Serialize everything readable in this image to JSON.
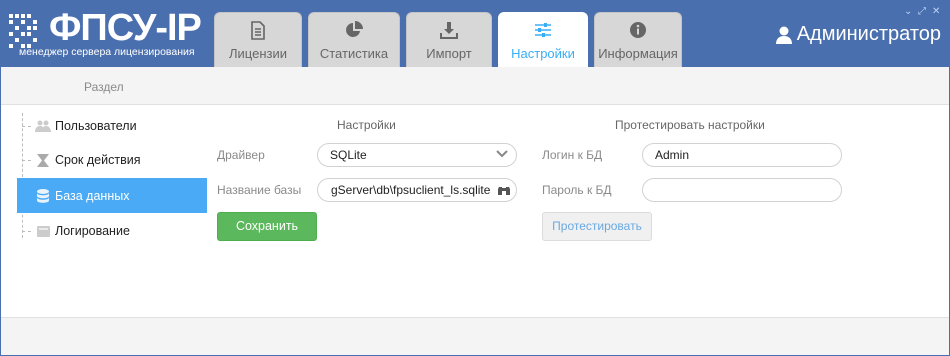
{
  "app": {
    "logo_text": "ФПСУ-IP",
    "logo_subtitle": "менеджер сервера лицензирования",
    "user_name": "Администратор"
  },
  "tabs": [
    {
      "label": "Лицензии",
      "icon": "document-icon"
    },
    {
      "label": "Статистика",
      "icon": "pie-chart-icon"
    },
    {
      "label": "Импорт",
      "icon": "download-icon"
    },
    {
      "label": "Настройки",
      "icon": "sliders-icon",
      "active": true
    },
    {
      "label": "Информация",
      "icon": "info-icon"
    }
  ],
  "breadcrumb": {
    "label": "Раздел"
  },
  "sidebar": {
    "items": [
      {
        "label": "Пользователи",
        "icon": "users-icon"
      },
      {
        "label": "Срок действия",
        "icon": "hourglass-icon"
      },
      {
        "label": "База данных",
        "icon": "database-icon",
        "active": true
      },
      {
        "label": "Логирование",
        "icon": "log-icon"
      }
    ]
  },
  "settings": {
    "heading": "Настройки",
    "driver_label": "Драйвер",
    "driver_value": "SQLite",
    "dbname_label": "Название базы",
    "dbname_value": "gServer\\db\\fpsuclient_ls.sqlite",
    "save_label": "Сохранить"
  },
  "test": {
    "heading": "Протестировать настройки",
    "login_label": "Логин к БД",
    "login_value": "Admin",
    "password_label": "Пароль к БД",
    "password_value": "",
    "test_label": "Протестировать"
  },
  "colors": {
    "header_bg": "#4a6fae",
    "accent": "#4aaaf5",
    "save_button": "#5cb85c"
  }
}
